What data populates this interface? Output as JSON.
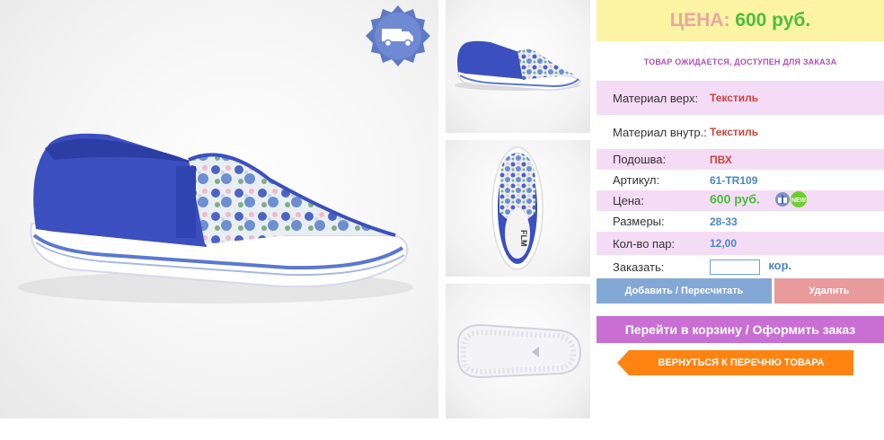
{
  "product": {
    "delivery_icon": "truck-icon",
    "images": [
      "main-shoe-photo",
      "side-view-thumbnail",
      "top-view-thumbnail",
      "sole-view-thumbnail"
    ]
  },
  "panel": {
    "price_label": "ЦЕНА:",
    "price_value": "600 руб.",
    "status": "ТОВАР ОЖИДАЕТСЯ, ДОСТУПЕН ДЛЯ ЗАКАЗА",
    "specs": [
      {
        "key": "Материал верх:",
        "value": "Текстиль"
      },
      {
        "key": "Материал внутр.:",
        "value": "Текстиль"
      },
      {
        "key": "Подошва:",
        "value": "ПВХ"
      },
      {
        "key": "Артикул:",
        "value": "61-TR109"
      },
      {
        "key": "Цена:",
        "value": "600 руб."
      },
      {
        "key": "Размеры:",
        "value": "28-33"
      },
      {
        "key": "Кол-во пар:",
        "value": "12,00"
      },
      {
        "key": "Заказать:",
        "value": "",
        "unit": "кор."
      }
    ],
    "badges": {
      "new_label": "NEW"
    },
    "buttons": {
      "add": "Добавить / Пересчитать",
      "delete": "Удалить",
      "cart": "Перейти в корзину / Оформить заказ",
      "back": "ВЕРНУТЬСЯ К ПЕРЕЧНЮ ТОВАРА"
    }
  },
  "colors": {
    "accent_blue": "#3b4fbf",
    "price_bg": "#fcf3a3",
    "price_green": "#4bbd3a",
    "row_pink": "#f5dcf6",
    "cart_purple": "#c96fd4",
    "back_orange": "#ff8311"
  }
}
